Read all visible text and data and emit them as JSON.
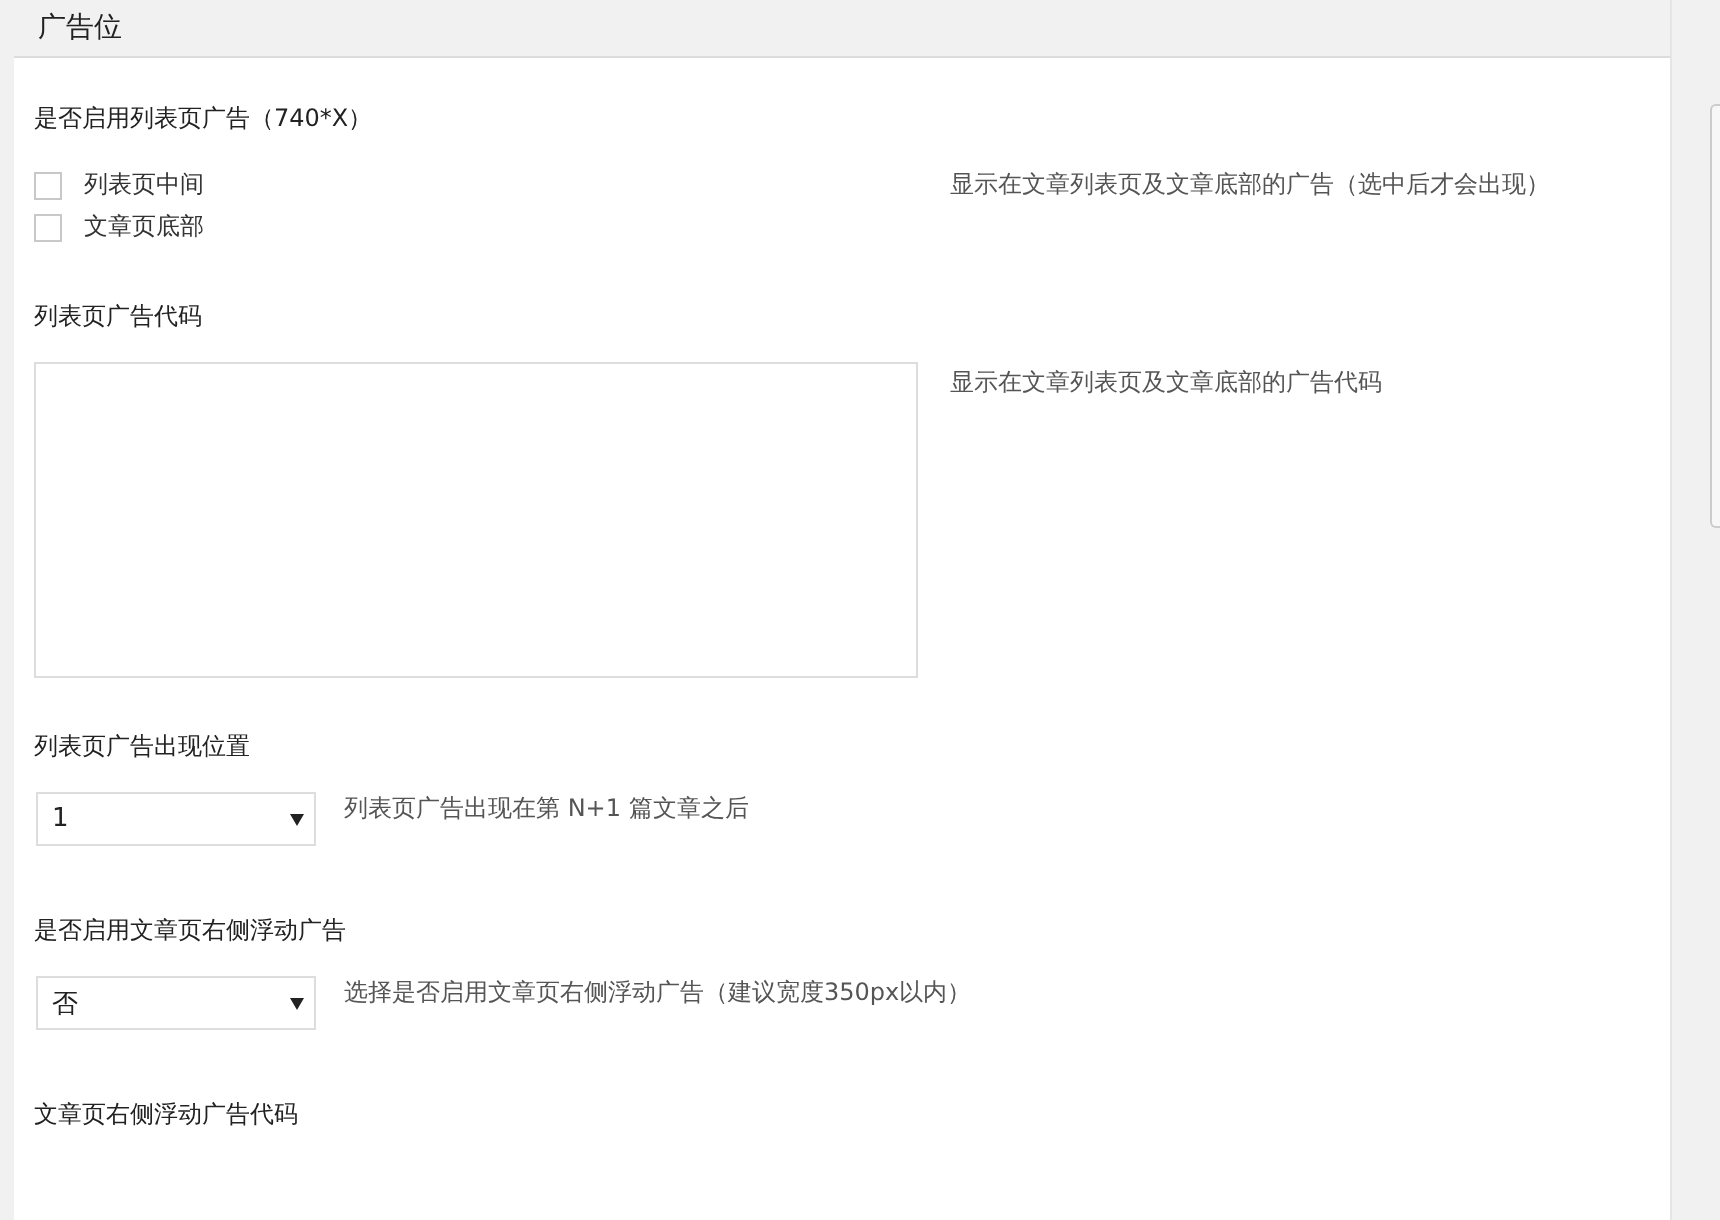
{
  "panel": {
    "title": "广告位"
  },
  "fields": [
    {
      "kind": "checkboxes",
      "label": "是否启用列表页广告（740*X）",
      "options": [
        {
          "label": "列表页中间",
          "checked": false
        },
        {
          "label": "文章页底部",
          "checked": false
        }
      ],
      "description": "显示在文章列表页及文章底部的广告（选中后才会出现）"
    },
    {
      "kind": "textarea",
      "label": "列表页广告代码",
      "description": "显示在文章列表页及文章底部的广告代码"
    },
    {
      "kind": "select",
      "label": "列表页广告出现位置",
      "value": "1",
      "description": "列表页广告出现在第 N+1 篇文章之后"
    },
    {
      "kind": "select",
      "label": "是否启用文章页右侧浮动广告",
      "value": "否",
      "description": "选择是否启用文章页右侧浮动广告（建议宽度350px以内）"
    },
    {
      "kind": "heading",
      "label": "文章页右侧浮动广告代码"
    }
  ]
}
